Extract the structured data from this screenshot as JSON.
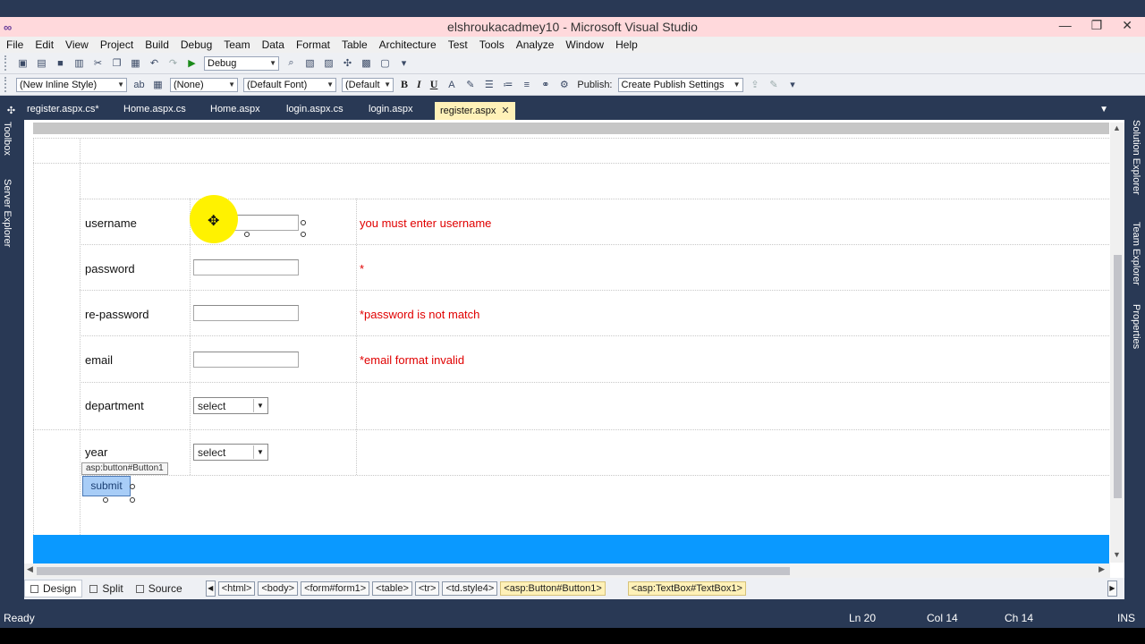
{
  "window": {
    "title": "elshroukacadmey10 - Microsoft Visual Studio"
  },
  "menu": [
    "File",
    "Edit",
    "View",
    "Project",
    "Build",
    "Debug",
    "Team",
    "Data",
    "Format",
    "Table",
    "Architecture",
    "Test",
    "Tools",
    "Analyze",
    "Window",
    "Help"
  ],
  "toolbar1": {
    "configuration": "Debug"
  },
  "toolbar2": {
    "style": "(New Inline Style)",
    "block_format": "(None)",
    "font": "(Default Font)",
    "size": "(Default",
    "bold": "B",
    "italic": "I",
    "underline": "U",
    "publish_label": "Publish:",
    "publish_settings": "Create Publish Settings"
  },
  "tabs": [
    "register.aspx.cs*",
    "Home.aspx.cs",
    "Home.aspx",
    "login.aspx.cs",
    "login.aspx",
    "register.aspx"
  ],
  "active_tab_close": "✕",
  "side_panels": {
    "left": [
      "Toolbox",
      "Server Explorer"
    ],
    "right": [
      "Solution Explorer",
      "Team Explorer",
      "Properties"
    ]
  },
  "form": {
    "username_label": "username",
    "password_label": "password",
    "repassword_label": "re-password",
    "email_label": "email",
    "department_label": "department",
    "year_label": "year",
    "department_value": "select",
    "year_value": "select",
    "error_username": "you must enter username",
    "error_password": "*",
    "error_repassword": "*password is not match",
    "error_email": "*email format invalid",
    "button_tag": "asp:button#Button1",
    "submit_label": "submit"
  },
  "view_buttons": [
    "Design",
    "Split",
    "Source"
  ],
  "breadcrumbs": [
    "<html>",
    "<body>",
    "<form#form1>",
    "<table>",
    "<tr>",
    "<td.style4>",
    "<asp:Button#Button1>",
    "<asp:TextBox#TextBox1>"
  ],
  "status": {
    "ready": "Ready",
    "line": "Ln 20",
    "col": "Col 14",
    "ch": "Ch 14",
    "mode": "INS"
  }
}
